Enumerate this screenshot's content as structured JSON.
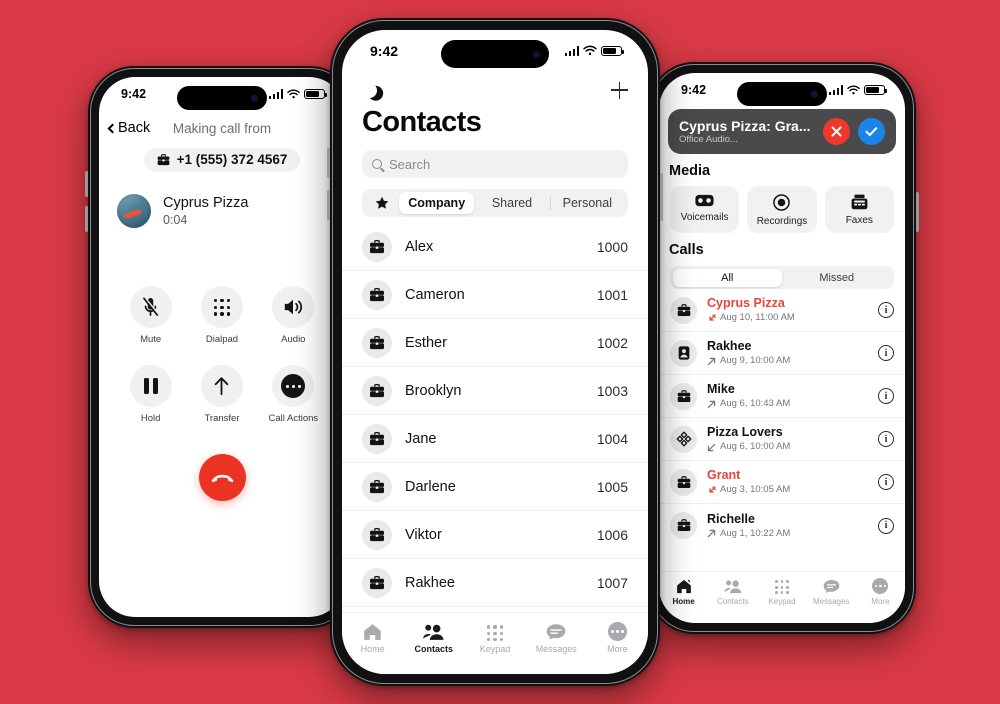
{
  "theme": {
    "background": "#d93a45",
    "accent_red": "#ea3323",
    "missed_red": "#e8453c",
    "accept_blue": "#1a85e8",
    "decline_red": "#f0372c"
  },
  "status_bar": {
    "time": "9:42"
  },
  "left_phone": {
    "nav": {
      "back_label": "Back",
      "title": "Making call from"
    },
    "caller_id": {
      "number": "+1 (555) 372 4567",
      "icon": "briefcase-icon"
    },
    "callee": {
      "name": "Cyprus Pizza",
      "duration": "0:04"
    },
    "actions": [
      {
        "label": "Mute",
        "icon": "mic-off-icon"
      },
      {
        "label": "Dialpad",
        "icon": "dialpad-icon"
      },
      {
        "label": "Audio",
        "icon": "speaker-icon"
      },
      {
        "label": "Hold",
        "icon": "pause-icon"
      },
      {
        "label": "Transfer",
        "icon": "arrow-up-icon"
      },
      {
        "label": "Call Actions",
        "icon": "ellipsis-icon"
      }
    ],
    "hangup": {
      "icon": "hangup-icon"
    }
  },
  "center_phone": {
    "topbar": {
      "moon_icon": "moon-icon",
      "add_icon": "plus-icon"
    },
    "title": "Contacts",
    "search": {
      "placeholder": "Search",
      "icon": "search-icon"
    },
    "segments": {
      "star_icon": "star-icon",
      "items": [
        "Company",
        "Shared",
        "Personal"
      ],
      "selected": "Company"
    },
    "contacts": [
      {
        "name": "Alex",
        "ext": "1000",
        "icon": "briefcase-icon"
      },
      {
        "name": "Cameron",
        "ext": "1001",
        "icon": "briefcase-icon"
      },
      {
        "name": "Esther",
        "ext": "1002",
        "icon": "briefcase-icon"
      },
      {
        "name": "Brooklyn",
        "ext": "1003",
        "icon": "briefcase-icon"
      },
      {
        "name": "Jane",
        "ext": "1004",
        "icon": "briefcase-icon"
      },
      {
        "name": "Darlene",
        "ext": "1005",
        "icon": "briefcase-icon"
      },
      {
        "name": "Viktor",
        "ext": "1006",
        "icon": "briefcase-icon"
      },
      {
        "name": "Rakhee",
        "ext": "1007",
        "icon": "briefcase-icon"
      }
    ],
    "tabs": [
      {
        "label": "Home",
        "icon": "home-icon",
        "active": false
      },
      {
        "label": "Contacts",
        "icon": "contacts-icon",
        "active": true
      },
      {
        "label": "Keypad",
        "icon": "keypad-icon",
        "active": false
      },
      {
        "label": "Messages",
        "icon": "messages-icon",
        "active": false
      },
      {
        "label": "More",
        "icon": "more-icon",
        "active": false
      }
    ]
  },
  "right_phone": {
    "banner": {
      "title": "Cyprus Pizza: Gra...",
      "subtitle": "Office Audio...",
      "decline_icon": "close-icon",
      "accept_icon": "check-icon"
    },
    "media_heading": "Media",
    "media": [
      {
        "label": "Voicemails",
        "icon": "voicemail-icon"
      },
      {
        "label": "Recordings",
        "icon": "record-icon"
      },
      {
        "label": "Faxes",
        "icon": "fax-icon"
      }
    ],
    "calls_heading": "Calls",
    "calls_filter": {
      "items": [
        "All",
        "Missed"
      ],
      "selected": "All"
    },
    "calls": [
      {
        "name": "Cyprus Pizza",
        "time": "Aug 10, 11:00 AM",
        "missed": true,
        "direction": "missed",
        "icon": "briefcase-icon",
        "info_icon": "info-icon"
      },
      {
        "name": "Rakhee",
        "time": "Aug 9, 10:00 AM",
        "missed": false,
        "direction": "outgoing",
        "icon": "contact-card-icon",
        "info_icon": "info-icon"
      },
      {
        "name": "Mike",
        "time": "Aug 6, 10:43 AM",
        "missed": false,
        "direction": "outgoing",
        "icon": "briefcase-icon",
        "info_icon": "info-icon"
      },
      {
        "name": "Pizza Lovers",
        "time": "Aug 6, 10:00 AM",
        "missed": false,
        "direction": "incoming",
        "icon": "group-icon",
        "info_icon": "info-icon"
      },
      {
        "name": "Grant",
        "time": "Aug 3, 10:05 AM",
        "missed": true,
        "direction": "missed",
        "icon": "briefcase-icon",
        "info_icon": "info-icon"
      },
      {
        "name": "Richelle",
        "time": "Aug 1, 10:22 AM",
        "missed": false,
        "direction": "outgoing",
        "icon": "briefcase-icon",
        "info_icon": "info-icon"
      }
    ],
    "tabs": [
      {
        "label": "Home",
        "icon": "home-icon",
        "active": true
      },
      {
        "label": "Contacts",
        "icon": "contacts-icon",
        "active": false
      },
      {
        "label": "Keypad",
        "icon": "keypad-icon",
        "active": false
      },
      {
        "label": "Messages",
        "icon": "messages-icon",
        "active": false
      },
      {
        "label": "More",
        "icon": "more-icon",
        "active": false
      }
    ]
  }
}
